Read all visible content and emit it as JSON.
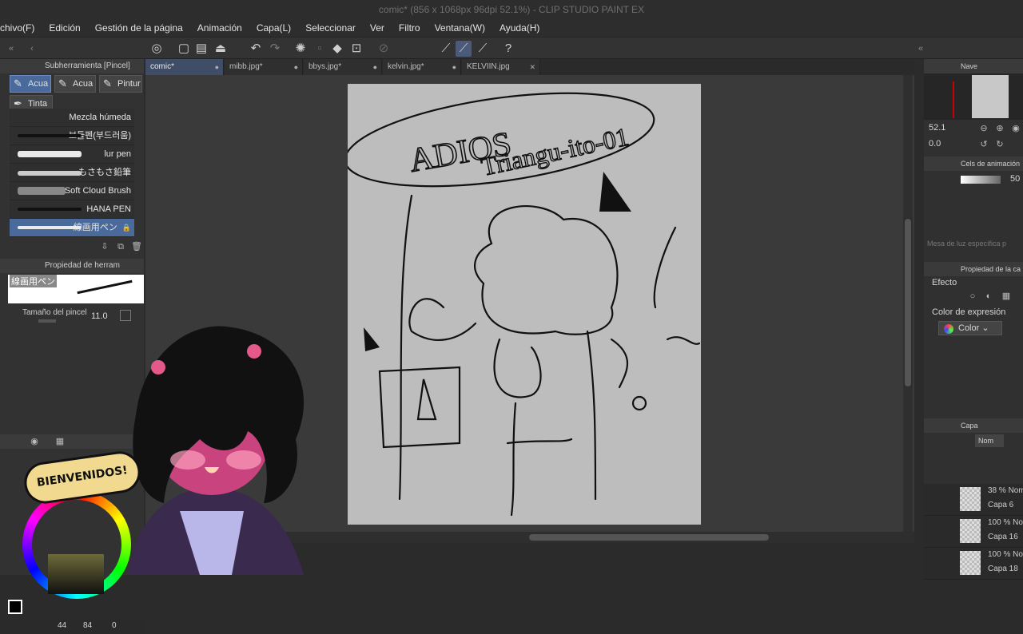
{
  "window_title": "comic* (856 x 1068px 96dpi 52.1%)  - CLIP STUDIO PAINT EX",
  "menu": [
    "chivo(F)",
    "Edición",
    "Gestión de la página",
    "Animación",
    "Capa(L)",
    "Seleccionar",
    "Ver",
    "Filtro",
    "Ventana(W)",
    "Ayuda(H)"
  ],
  "sub_tool_panel": {
    "title": "Subherramienta [Pincel]",
    "groups": [
      "Acua",
      "Acua",
      "Pintur",
      "Tinta"
    ],
    "brushes": [
      "Mezcla húmeda",
      "보들펜(부드러움)",
      "lur pen",
      "もさもさ鉛筆",
      "Soft Cloud Brush",
      "HANA PEN",
      "線画用ペン"
    ]
  },
  "tool_property": {
    "title": "Propiedad de herram",
    "preset_name": "線画用ペン",
    "brush_size_label": "Tamaño del pincel",
    "brush_size_value": "11.0"
  },
  "color": {
    "values": [
      "44",
      "84",
      "0"
    ]
  },
  "tabs": [
    "comic*",
    "mibb.jpg*",
    "bbys.jpg*",
    "kelvin.jpg*",
    "KELVIIN.jpg"
  ],
  "canvas_text": {
    "line1": "ADIOS",
    "line2": "Triangu-ito-01"
  },
  "overlay_sign": "BIENVENIDOS!",
  "right_panel": {
    "navigator_title": "Nave",
    "zoom": "52.1",
    "rotate": "0.0",
    "animation_title": "Cels de animación",
    "animation_value": "50",
    "lightbox_label": "Mesa de luz específica p",
    "layer_property_title": "Propiedad de la ca",
    "effect_label": "Efecto",
    "expression_color_label": "Color de expresión",
    "expression_color_value": "Color",
    "layers_title": "Capa",
    "blend_mode": "Nom",
    "layers": [
      {
        "opacity": "38 % Nom",
        "name": "Capa 6"
      },
      {
        "opacity": "100 % No",
        "name": "Capa 16"
      },
      {
        "opacity": "100 % No",
        "name": "Capa 18"
      }
    ]
  },
  "colors": {
    "accent": "#4a6a9c",
    "canvas_bg": "#3a3a3a",
    "paper": "#bdbdbd"
  }
}
